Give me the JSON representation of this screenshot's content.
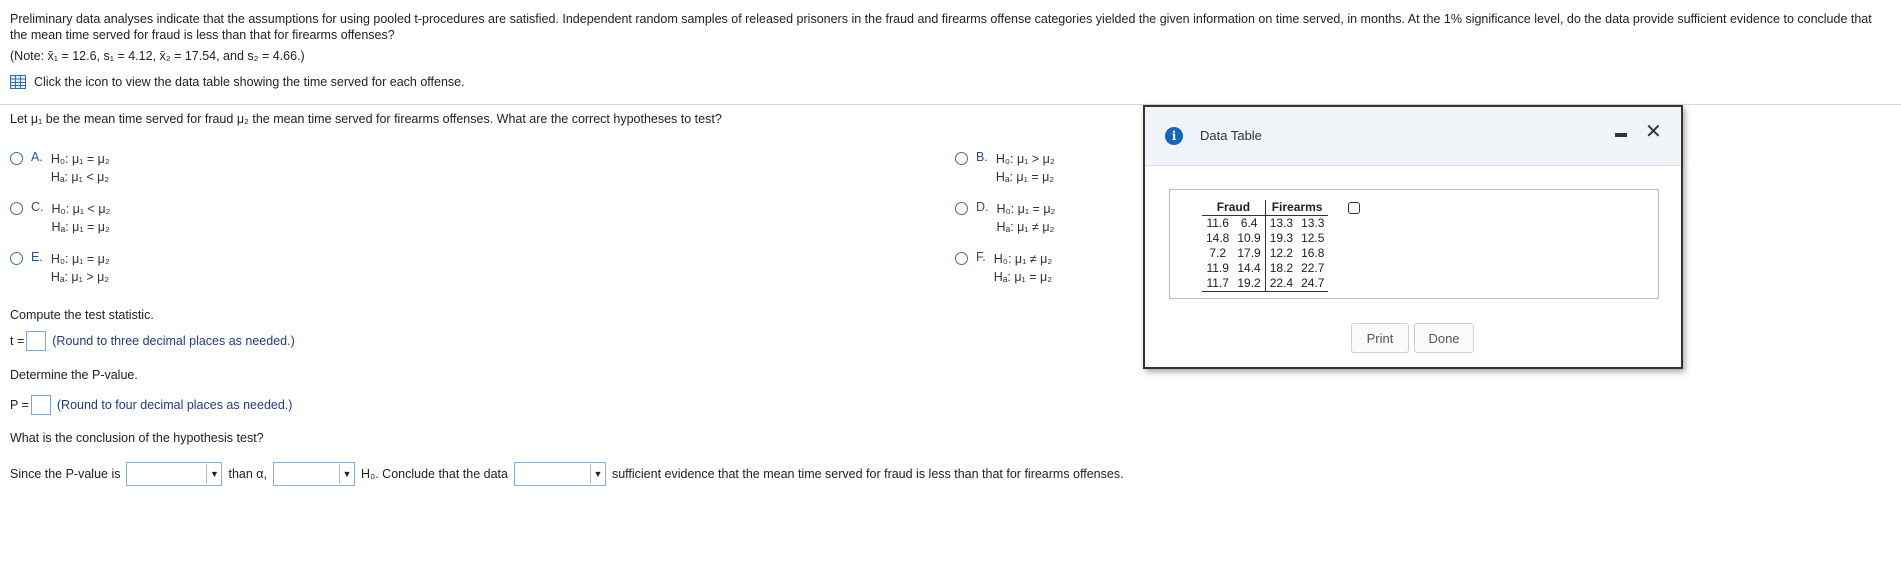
{
  "problem": {
    "text": "Preliminary data analyses indicate that the assumptions for using pooled t-procedures are satisfied. Independent random samples of released prisoners in the fraud and firearms offense categories yielded the given information on time served, in months. At the 1% significance level, do the data provide sufficient evidence to conclude that the mean time served for fraud is less than that for firearms offenses?",
    "note": "(Note: x̄₁ = 12.6, s₁ = 4.12, x̄₂ = 17.54, and s₂ = 4.66.)",
    "icon_text": "Click the icon to view the data table showing the time served for each offense."
  },
  "hypotheses": {
    "question": "Let μ₁ be the mean time served for fraud μ₂ the mean time served for firearms offenses. What are the correct hypotheses to test?",
    "options": [
      {
        "letter": "A.",
        "h0": "H₀: μ₁ = μ₂",
        "ha": "Hₐ: μ₁ < μ₂"
      },
      {
        "letter": "B.",
        "h0": "H₀: μ₁ > μ₂",
        "ha": "Hₐ: μ₁ = μ₂"
      },
      {
        "letter": "C.",
        "h0": "H₀: μ₁ < μ₂",
        "ha": "Hₐ: μ₁ = μ₂"
      },
      {
        "letter": "D.",
        "h0": "H₀: μ₁ = μ₂",
        "ha": "Hₐ: μ₁ ≠ μ₂"
      },
      {
        "letter": "E.",
        "h0": "H₀: μ₁ = μ₂",
        "ha": "Hₐ: μ₁ > μ₂"
      },
      {
        "letter": "F.",
        "h0": "H₀: μ₁ ≠ μ₂",
        "ha": "Hₐ: μ₁ = μ₂"
      }
    ]
  },
  "test_stat": {
    "prompt": "Compute the test statistic.",
    "label": "t =",
    "hint": "(Round to three decimal places as needed.)"
  },
  "p_value": {
    "prompt": "Determine the P-value.",
    "label": "P =",
    "hint": "(Round to four decimal places as needed.)"
  },
  "conclusion": {
    "prompt": "What is the conclusion of the hypothesis test?",
    "part1": "Since the P-value is",
    "part2": "than α,",
    "part3": "H₀. Conclude that the data",
    "part4": "sufficient evidence that the mean time served for fraud is less than that for firearms offenses."
  },
  "dialog": {
    "title": "Data Table",
    "headers": [
      "Fraud",
      "Firearms"
    ],
    "rows": [
      [
        "11.6",
        "6.4",
        "13.3",
        "13.3"
      ],
      [
        "14.8",
        "10.9",
        "19.3",
        "12.5"
      ],
      [
        "7.2",
        "17.9",
        "12.2",
        "16.8"
      ],
      [
        "11.9",
        "14.4",
        "18.2",
        "22.7"
      ],
      [
        "11.7",
        "19.2",
        "22.4",
        "24.7"
      ]
    ],
    "print_label": "Print",
    "done_label": "Done"
  }
}
